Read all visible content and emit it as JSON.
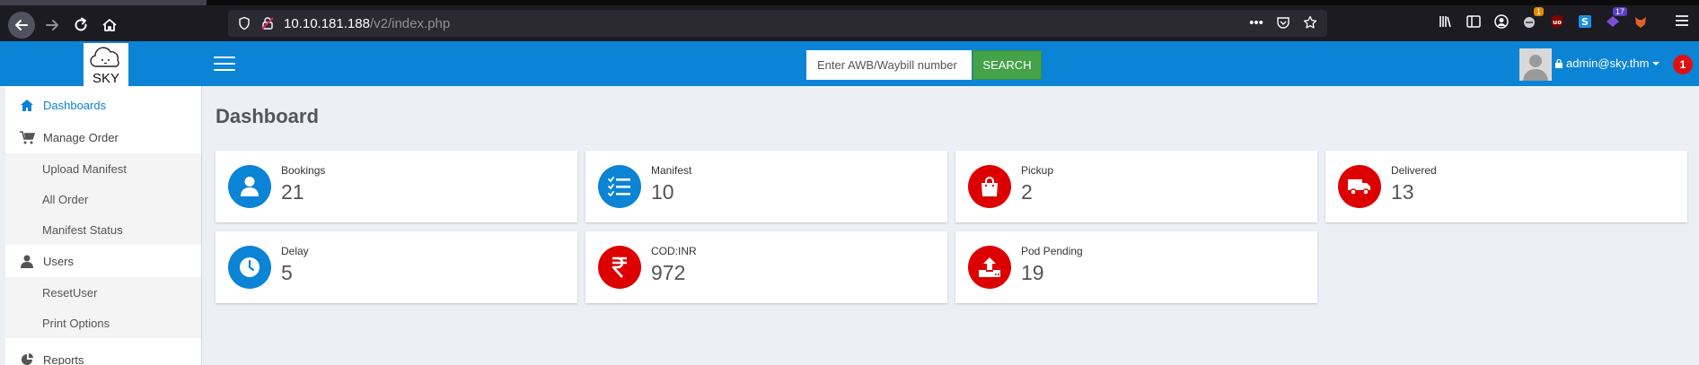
{
  "browser": {
    "url_host": "10.10.181.188",
    "url_path": "/v2/index.php",
    "badges": {
      "ext1": "1",
      "ext2": "17"
    }
  },
  "header": {
    "logo_text": "SKY",
    "search_placeholder": "Enter AWB/Waybill number",
    "search_button": "SEARCH",
    "user": "admin@sky.thm",
    "notification_count": "1",
    "brand_color": "#0b84d6"
  },
  "sidebar": {
    "items": [
      {
        "label": "Dashboards",
        "icon": "home-icon"
      },
      {
        "label": "Manage Order",
        "icon": "cart-icon"
      },
      {
        "label": "Upload Manifest"
      },
      {
        "label": "All Order"
      },
      {
        "label": "Manifest Status"
      },
      {
        "label": "Users",
        "icon": "user-icon"
      },
      {
        "label": "ResetUser"
      },
      {
        "label": "Print Options"
      },
      {
        "label": "Reports",
        "icon": "reports-icon"
      }
    ]
  },
  "main": {
    "title": "Dashboard",
    "cards": [
      {
        "label": "Bookings",
        "value": "21",
        "icon": "user-icon",
        "color": "#0b84d6"
      },
      {
        "label": "Manifest",
        "value": "10",
        "icon": "list-icon",
        "color": "#0b84d6"
      },
      {
        "label": "Pickup",
        "value": "2",
        "icon": "bag-icon",
        "color": "#dd0000"
      },
      {
        "label": "Delivered",
        "value": "13",
        "icon": "truck-icon",
        "color": "#dd0000"
      },
      {
        "label": "Delay",
        "value": "5",
        "icon": "clock-icon",
        "color": "#0b84d6"
      },
      {
        "label": "COD:INR",
        "value": "972",
        "icon": "rupee-icon",
        "color": "#dd0000"
      },
      {
        "label": "Pod Pending",
        "value": "19",
        "icon": "upload-icon",
        "color": "#dd0000"
      }
    ]
  }
}
